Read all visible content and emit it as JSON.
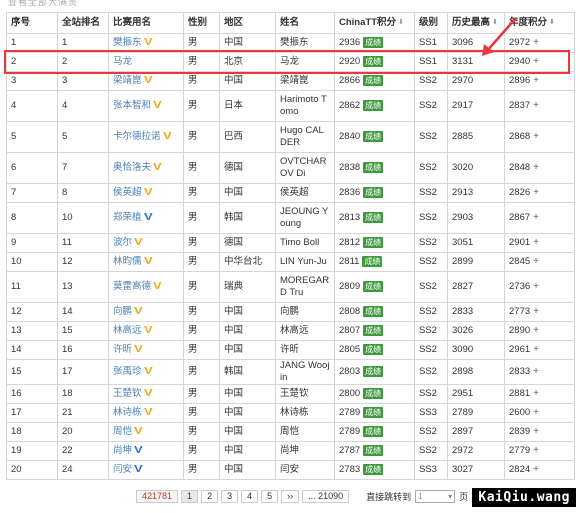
{
  "top_cut_text": "查看全部大满贯",
  "headers": {
    "seq": "序号",
    "site_rank": "全站排名",
    "name": "比赛用名",
    "gender": "性别",
    "region": "地区",
    "fullname": "姓名",
    "score": "ChinaTT积分",
    "level": "级别",
    "history": "历史最高",
    "annual": "年度积分"
  },
  "score_button_label": "成绩",
  "plus_label": "+",
  "rows": [
    {
      "seq": "1",
      "rank": "1",
      "name": "樊振东",
      "badge": "gold",
      "gender": "男",
      "region": "中国",
      "fullname": "樊振东",
      "score": "2936",
      "level": "SS1",
      "history": "3096",
      "annual": "2972"
    },
    {
      "seq": "2",
      "rank": "2",
      "name": "马龙",
      "badge": "",
      "gender": "男",
      "region": "北京",
      "fullname": "马龙",
      "score": "2920",
      "level": "SS1",
      "history": "3131",
      "annual": "2940"
    },
    {
      "seq": "3",
      "rank": "3",
      "name": "梁靖崑",
      "badge": "gold",
      "gender": "男",
      "region": "中国",
      "fullname": "梁靖崑",
      "score": "2866",
      "level": "SS2",
      "history": "2970",
      "annual": "2896"
    },
    {
      "seq": "4",
      "rank": "4",
      "name": "张本智和",
      "badge": "gold",
      "gender": "男",
      "region": "日本",
      "fullname": "Harimoto Tomo",
      "score": "2862",
      "level": "SS2",
      "history": "2917",
      "annual": "2837"
    },
    {
      "seq": "5",
      "rank": "5",
      "name": "卡尔德拉诺",
      "badge": "gold",
      "gender": "男",
      "region": "巴西",
      "fullname": "Hugo CALDER",
      "score": "2840",
      "level": "SS2",
      "history": "2885",
      "annual": "2868"
    },
    {
      "seq": "6",
      "rank": "7",
      "name": "奥恰洛夫",
      "badge": "gold",
      "gender": "男",
      "region": "德国",
      "fullname": "OVTCHAROV Di",
      "score": "2838",
      "level": "SS2",
      "history": "3020",
      "annual": "2848"
    },
    {
      "seq": "7",
      "rank": "8",
      "name": "侯英超",
      "badge": "gold",
      "gender": "男",
      "region": "中国",
      "fullname": "侯英超",
      "score": "2836",
      "level": "SS2",
      "history": "2913",
      "annual": "2826"
    },
    {
      "seq": "8",
      "rank": "10",
      "name": "郑荣植",
      "badge": "blue",
      "gender": "男",
      "region": "韩国",
      "fullname": "JEOUNG Young",
      "score": "2813",
      "level": "SS2",
      "history": "2903",
      "annual": "2867"
    },
    {
      "seq": "9",
      "rank": "11",
      "name": "波尔",
      "badge": "gold",
      "gender": "男",
      "region": "德国",
      "fullname": "Timo Boll",
      "score": "2812",
      "level": "SS2",
      "history": "3051",
      "annual": "2901"
    },
    {
      "seq": "10",
      "rank": "12",
      "name": "林昀儒",
      "badge": "gold",
      "gender": "男",
      "region": "中华台北",
      "fullname": "LIN Yun-Ju",
      "score": "2811",
      "level": "SS2",
      "history": "2899",
      "annual": "2845"
    },
    {
      "seq": "11",
      "rank": "13",
      "name": "莫雷高德",
      "badge": "gold",
      "gender": "男",
      "region": "瑞典",
      "fullname": "MOREGARD Tru",
      "score": "2809",
      "level": "SS2",
      "history": "2827",
      "annual": "2736"
    },
    {
      "seq": "12",
      "rank": "14",
      "name": "向鹏",
      "badge": "gold",
      "gender": "男",
      "region": "中国",
      "fullname": "向鹏",
      "score": "2808",
      "level": "SS2",
      "history": "2833",
      "annual": "2773"
    },
    {
      "seq": "13",
      "rank": "15",
      "name": "林高远",
      "badge": "gold",
      "gender": "男",
      "region": "中国",
      "fullname": "林高远",
      "score": "2807",
      "level": "SS2",
      "history": "3026",
      "annual": "2890"
    },
    {
      "seq": "14",
      "rank": "16",
      "name": "许昕",
      "badge": "gold",
      "gender": "男",
      "region": "中国",
      "fullname": "许昕",
      "score": "2805",
      "level": "SS2",
      "history": "3090",
      "annual": "2961"
    },
    {
      "seq": "15",
      "rank": "17",
      "name": "张禹珍",
      "badge": "gold",
      "gender": "男",
      "region": "韩国",
      "fullname": "JANG Woojin",
      "score": "2803",
      "level": "SS2",
      "history": "2898",
      "annual": "2833"
    },
    {
      "seq": "16",
      "rank": "18",
      "name": "王楚钦",
      "badge": "gold",
      "gender": "男",
      "region": "中国",
      "fullname": "王楚钦",
      "score": "2800",
      "level": "SS2",
      "history": "2951",
      "annual": "2881"
    },
    {
      "seq": "17",
      "rank": "21",
      "name": "林诗栋",
      "badge": "gold",
      "gender": "男",
      "region": "中国",
      "fullname": "林诗栋",
      "score": "2789",
      "level": "SS3",
      "history": "2789",
      "annual": "2600"
    },
    {
      "seq": "18",
      "rank": "20",
      "name": "周恺",
      "badge": "gold",
      "gender": "男",
      "region": "中国",
      "fullname": "周恺",
      "score": "2789",
      "level": "SS2",
      "history": "2897",
      "annual": "2839"
    },
    {
      "seq": "19",
      "rank": "22",
      "name": "尚坤",
      "badge": "blue",
      "gender": "男",
      "region": "中国",
      "fullname": "尚坤",
      "score": "2787",
      "level": "SS2",
      "history": "2972",
      "annual": "2779"
    },
    {
      "seq": "20",
      "rank": "24",
      "name": "闫安",
      "badge": "blue",
      "gender": "男",
      "region": "中国",
      "fullname": "闫安",
      "score": "2783",
      "level": "SS3",
      "history": "3027",
      "annual": "2824"
    }
  ],
  "pager": {
    "total": "421781",
    "pages": [
      "1",
      "2",
      "3",
      "4",
      "5"
    ],
    "next": "››",
    "last": "... 21090",
    "jump_label": "直接跳转到",
    "jump_value": "1",
    "page_unit": "页"
  },
  "watermark": "KaiQiu.wang",
  "colors": {
    "highlight": "#e8383d",
    "score_button": "#3d9a3d",
    "link": "#4a7fb8",
    "badge_gold": "#f0a818",
    "badge_blue": "#2d6fd0"
  }
}
